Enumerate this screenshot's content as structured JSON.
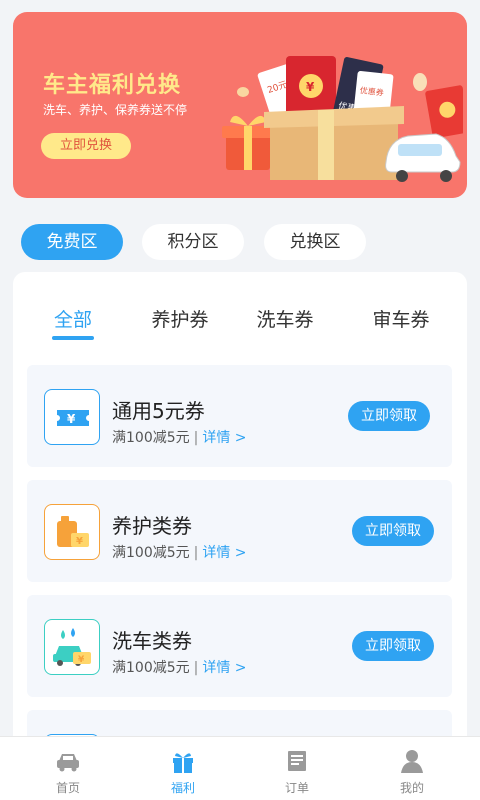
{
  "banner": {
    "title": "车主福利兑换",
    "subtitle": "洗车、养护、保养券送不停",
    "button_label": "立即兑换",
    "art_coupon_1": "20元",
    "art_coupon_2": "优惠券",
    "art_coupon_3": "优惠券",
    "art_yen": "¥",
    "bg_color": "#f8756b",
    "accent_color": "#ffe98a"
  },
  "zones": [
    {
      "label": "免费区",
      "active": true
    },
    {
      "label": "积分区",
      "active": false
    },
    {
      "label": "兑换区",
      "active": false
    }
  ],
  "tabs": [
    {
      "label": "全部",
      "active": true
    },
    {
      "label": "养护券",
      "active": false
    },
    {
      "label": "洗车券",
      "active": false
    },
    {
      "label": "审车券",
      "active": false
    }
  ],
  "coupons": [
    {
      "title": "通用5元券",
      "condition": "满100减5元",
      "separator": "|",
      "detail": "详情 >",
      "button": "立即领取",
      "icon": "ticket-icon"
    },
    {
      "title": "养护类券",
      "condition": "满100减5元",
      "separator": "|",
      "detail": "详情 >",
      "button": "立即领取",
      "icon": "oil-can-icon"
    },
    {
      "title": "洗车类券",
      "condition": "满100减5元",
      "separator": "|",
      "detail": "详情 >",
      "button": "立即领取",
      "icon": "car-wash-icon"
    }
  ],
  "nav": [
    {
      "label": "首页",
      "icon": "car-icon",
      "active": false
    },
    {
      "label": "福利",
      "icon": "gift-icon",
      "active": true
    },
    {
      "label": "订单",
      "icon": "order-icon",
      "active": false
    },
    {
      "label": "我的",
      "icon": "user-icon",
      "active": false
    }
  ],
  "colors": {
    "primary": "#2fa3f2",
    "background": "#f2f4f7"
  }
}
